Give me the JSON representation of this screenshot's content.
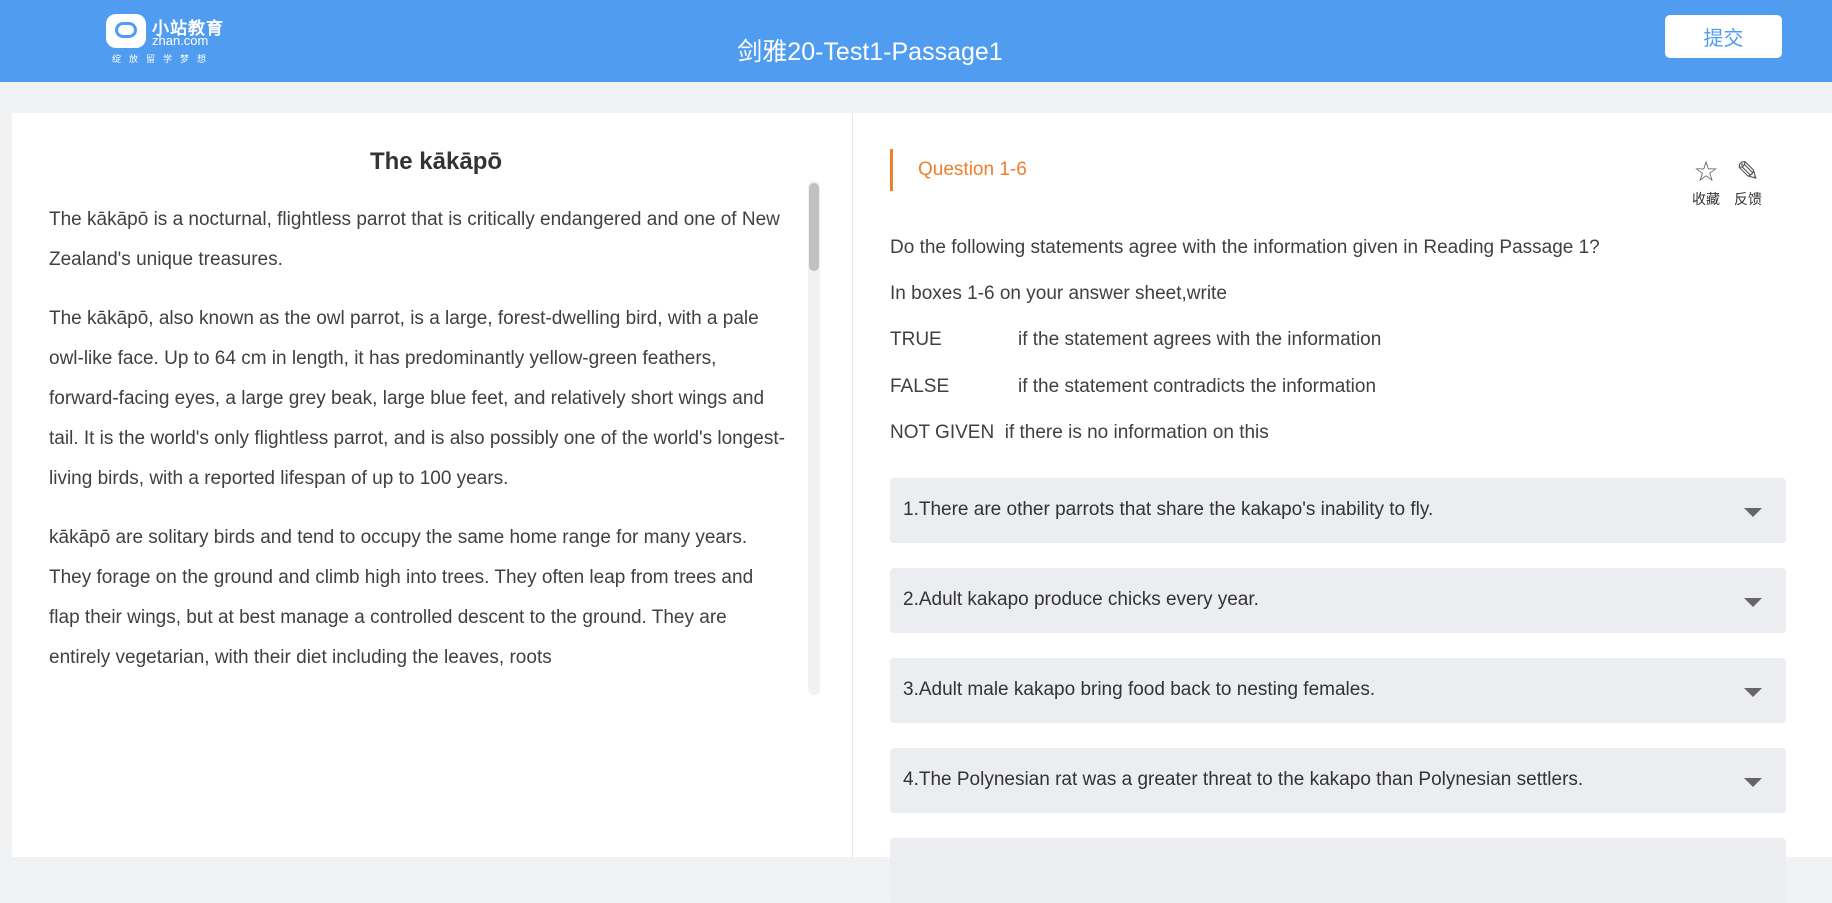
{
  "header": {
    "logo_cn": "小站教育",
    "logo_en": "zhan.com",
    "logo_slogan": "绽放留学梦想",
    "title": "剑雅20-Test1-Passage1",
    "submit_label": "提交"
  },
  "passage": {
    "title": "The kākāpō",
    "paragraphs": [
      "The kākāpō is a nocturnal, flightless parrot that is critically endangered and one of New Zealand's unique treasures.",
      "The kākāpō, also known as the owl parrot, is a large, forest-dwelling bird, with a pale owl-like face. Up to 64 cm in length, it has predominantly yellow-green feathers, forward-facing eyes, a large grey beak, large blue feet, and relatively short wings and tail. It is the world's only flightless parrot, and is also possibly one of the world's longest-living birds, with a reported lifespan of up to 100 years.",
      "kākāpō are solitary birds and tend to occupy the same home range for many years. They forage on the ground and climb high into trees. They often leap from trees and flap their wings, but at best manage a controlled descent to the ground. They are entirely vegetarian, with their diet including the leaves, roots"
    ]
  },
  "questions": {
    "range_label": "Question 1-6",
    "favorite_label": "收藏",
    "feedback_label": "反馈",
    "instruction": "Do the following statements agree with the information given in Reading Passage 1?",
    "boxes_line": "In boxes 1-6 on your answer sheet,write",
    "options": [
      {
        "key": "TRUE",
        "desc": "if the statement agrees with the information"
      },
      {
        "key": "FALSE",
        "desc": "if the statement contradicts the information"
      },
      {
        "key": "NOT GIVEN",
        "desc": "if there is no information on this"
      }
    ],
    "items": [
      "1.There are other parrots that share the kakapo's inability to fly.",
      "2.Adult kakapo produce chicks every year.",
      "3.Adult male kakapo bring food back to nesting females.",
      "4.The Polynesian rat was a greater threat to the kakapo than Polynesian settlers.",
      ""
    ]
  },
  "icons": {
    "favorite": "star-icon",
    "feedback": "edit-icon",
    "dropdown": "caret-down-icon"
  }
}
